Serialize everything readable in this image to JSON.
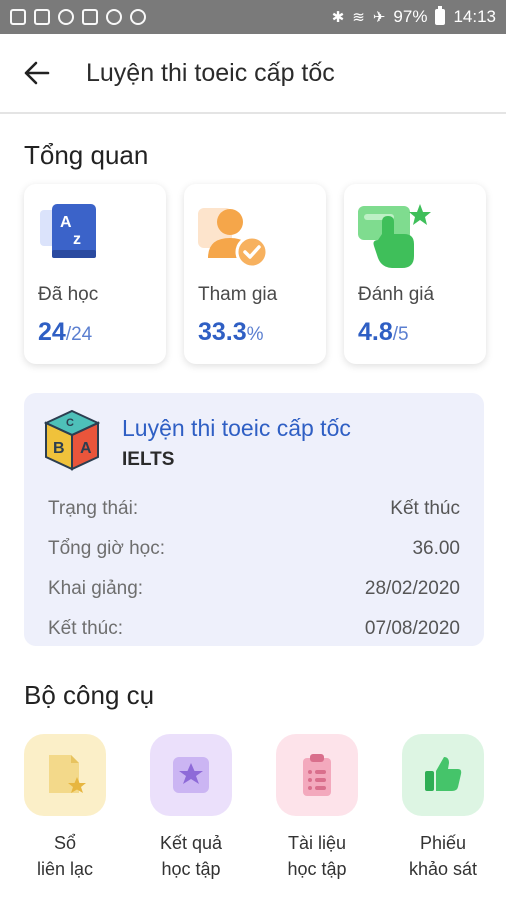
{
  "status_bar": {
    "battery": "97%",
    "time": "14:13"
  },
  "app_bar": {
    "title": "Luyện thi toeic cấp tốc"
  },
  "overview": {
    "heading": "Tổng quan",
    "cards": [
      {
        "icon": "book-az-icon",
        "label": "Đã học",
        "value": "24",
        "suffix": "/24"
      },
      {
        "icon": "user-check-icon",
        "label": "Tham gia",
        "value": "33.3",
        "suffix": "%"
      },
      {
        "icon": "hand-star-icon",
        "label": "Đánh giá",
        "value": "4.8",
        "suffix": "/5"
      }
    ]
  },
  "course": {
    "name": "Luyện thi toeic cấp tốc",
    "type": "IELTS",
    "rows": [
      {
        "label": "Trạng thái:",
        "value": "Kết thúc"
      },
      {
        "label": "Tổng giờ học:",
        "value": "36.00"
      },
      {
        "label": "Khai giảng:",
        "value": "28/02/2020"
      },
      {
        "label": "Kết thúc:",
        "value": "07/08/2020"
      }
    ]
  },
  "tools": {
    "heading": "Bộ công cụ",
    "items": [
      {
        "icon": "notebook-star-icon",
        "line1": "Sổ",
        "line2": "liên lạc",
        "color": "#fbefc8"
      },
      {
        "icon": "star-square-icon",
        "line1": "Kết quả",
        "line2": "học tập",
        "color": "#ebe0fb"
      },
      {
        "icon": "clipboard-icon",
        "line1": "Tài liệu",
        "line2": "học tập",
        "color": "#fde3ea"
      },
      {
        "icon": "thumbs-up-icon",
        "line1": "Phiếu",
        "line2": "khảo sát",
        "color": "#ddf5e3"
      }
    ]
  }
}
